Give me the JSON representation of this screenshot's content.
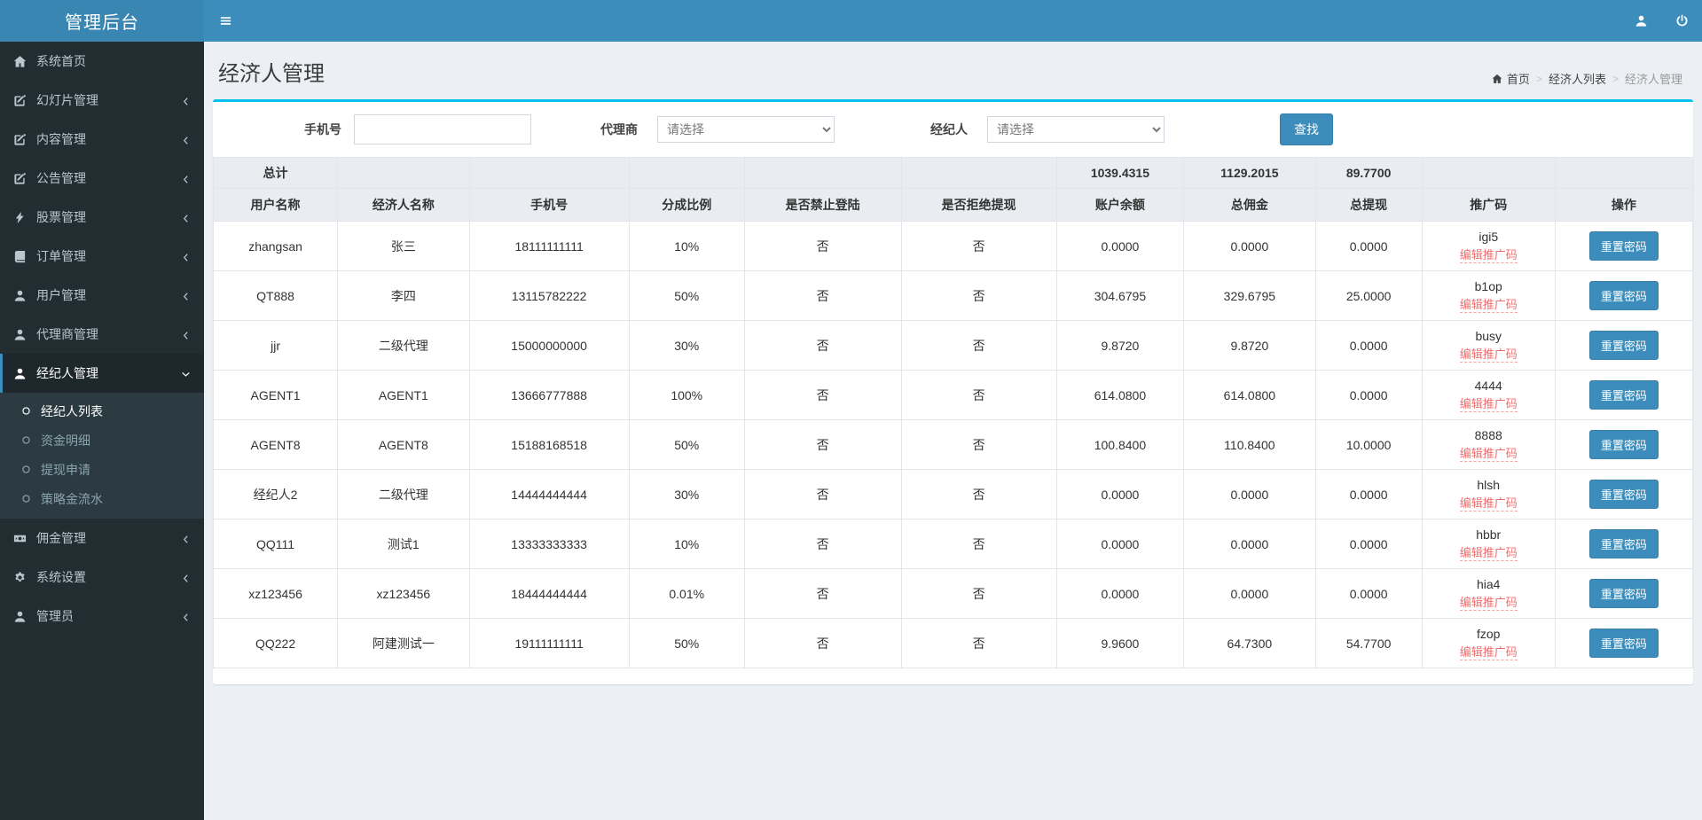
{
  "app": {
    "title": "管理后台"
  },
  "navbar": {
    "icons": [
      "user",
      "power"
    ]
  },
  "sidebar": {
    "items": [
      {
        "label": "系统首页",
        "icon": "home",
        "expandable": false
      },
      {
        "label": "幻灯片管理",
        "icon": "edit",
        "expandable": true
      },
      {
        "label": "内容管理",
        "icon": "edit",
        "expandable": true
      },
      {
        "label": "公告管理",
        "icon": "edit",
        "expandable": true
      },
      {
        "label": "股票管理",
        "icon": "bolt",
        "expandable": true
      },
      {
        "label": "订单管理",
        "icon": "book",
        "expandable": true
      },
      {
        "label": "用户管理",
        "icon": "user",
        "expandable": true
      },
      {
        "label": "代理商管理",
        "icon": "user",
        "expandable": true
      },
      {
        "label": "经纪人管理",
        "icon": "user",
        "expandable": true,
        "active": true,
        "expanded": true,
        "children": [
          {
            "label": "经纪人列表",
            "active": true
          },
          {
            "label": "资金明细",
            "active": false
          },
          {
            "label": "提现申请",
            "active": false
          },
          {
            "label": "策略金流水",
            "active": false
          }
        ]
      },
      {
        "label": "佣金管理",
        "icon": "money",
        "expandable": true
      },
      {
        "label": "系统设置",
        "icon": "gear",
        "expandable": true
      },
      {
        "label": "管理员",
        "icon": "user",
        "expandable": true
      }
    ]
  },
  "page": {
    "title": "经济人管理",
    "breadcrumb": {
      "home": "首页",
      "middle": "经济人列表",
      "current": "经济人管理"
    }
  },
  "filters": {
    "phone_label": "手机号",
    "phone_value": "",
    "agent_label": "代理商",
    "broker_label": "经纪人",
    "select_placeholder": "请选择",
    "search_button": "查找"
  },
  "table": {
    "total_label": "总计",
    "totals": {
      "balance": "1039.4315",
      "commission": "1129.2015",
      "withdraw": "89.7700"
    },
    "columns": [
      "用户名称",
      "经济人名称",
      "手机号",
      "分成比例",
      "是否禁止登陆",
      "是否拒绝提现",
      "账户余额",
      "总佣金",
      "总提现",
      "推广码",
      "操作"
    ],
    "edit_code_link": "编辑推广码",
    "reset_button": "重置密码",
    "rows": [
      {
        "username": "zhangsan",
        "broker_name": "张三",
        "phone": "18111111111",
        "ratio": "10%",
        "forbid_login": "否",
        "refuse_withdraw": "否",
        "balance": "0.0000",
        "commission": "0.0000",
        "withdraw": "0.0000",
        "promo_code": "igi5"
      },
      {
        "username": "QT888",
        "broker_name": "李四",
        "phone": "13115782222",
        "ratio": "50%",
        "forbid_login": "否",
        "refuse_withdraw": "否",
        "balance": "304.6795",
        "commission": "329.6795",
        "withdraw": "25.0000",
        "promo_code": "b1op"
      },
      {
        "username": "jjr",
        "broker_name": "二级代理",
        "phone": "15000000000",
        "ratio": "30%",
        "forbid_login": "否",
        "refuse_withdraw": "否",
        "balance": "9.8720",
        "commission": "9.8720",
        "withdraw": "0.0000",
        "promo_code": "busy"
      },
      {
        "username": "AGENT1",
        "broker_name": "AGENT1",
        "phone": "13666777888",
        "ratio": "100%",
        "forbid_login": "否",
        "refuse_withdraw": "否",
        "balance": "614.0800",
        "commission": "614.0800",
        "withdraw": "0.0000",
        "promo_code": "4444"
      },
      {
        "username": "AGENT8",
        "broker_name": "AGENT8",
        "phone": "15188168518",
        "ratio": "50%",
        "forbid_login": "否",
        "refuse_withdraw": "否",
        "balance": "100.8400",
        "commission": "110.8400",
        "withdraw": "10.0000",
        "promo_code": "8888"
      },
      {
        "username": "经纪人2",
        "broker_name": "二级代理",
        "phone": "14444444444",
        "ratio": "30%",
        "forbid_login": "否",
        "refuse_withdraw": "否",
        "balance": "0.0000",
        "commission": "0.0000",
        "withdraw": "0.0000",
        "promo_code": "hlsh"
      },
      {
        "username": "QQ111",
        "broker_name": "测试1",
        "phone": "13333333333",
        "ratio": "10%",
        "forbid_login": "否",
        "refuse_withdraw": "否",
        "balance": "0.0000",
        "commission": "0.0000",
        "withdraw": "0.0000",
        "promo_code": "hbbr"
      },
      {
        "username": "xz123456",
        "broker_name": "xz123456",
        "phone": "18444444444",
        "ratio": "0.01%",
        "forbid_login": "否",
        "refuse_withdraw": "否",
        "balance": "0.0000",
        "commission": "0.0000",
        "withdraw": "0.0000",
        "promo_code": "hia4"
      },
      {
        "username": "QQ222",
        "broker_name": "阿建测试一",
        "phone": "19111111111",
        "ratio": "50%",
        "forbid_login": "否",
        "refuse_withdraw": "否",
        "balance": "9.9600",
        "commission": "64.7300",
        "withdraw": "54.7700",
        "promo_code": "fzop"
      }
    ]
  },
  "colors": {
    "navbar": "#3c8dbc",
    "logo": "#3a86b3",
    "sidebar_bg": "#222d32",
    "submenu_bg": "#2c3b41",
    "active_border": "#3c8dbc",
    "box_top_border": "#00c0ef",
    "button": "#3c8dbc",
    "table_head_bg": "#e9edf2",
    "edit_link_red": "#f56c6c",
    "content_bg": "#ecf0f5"
  }
}
